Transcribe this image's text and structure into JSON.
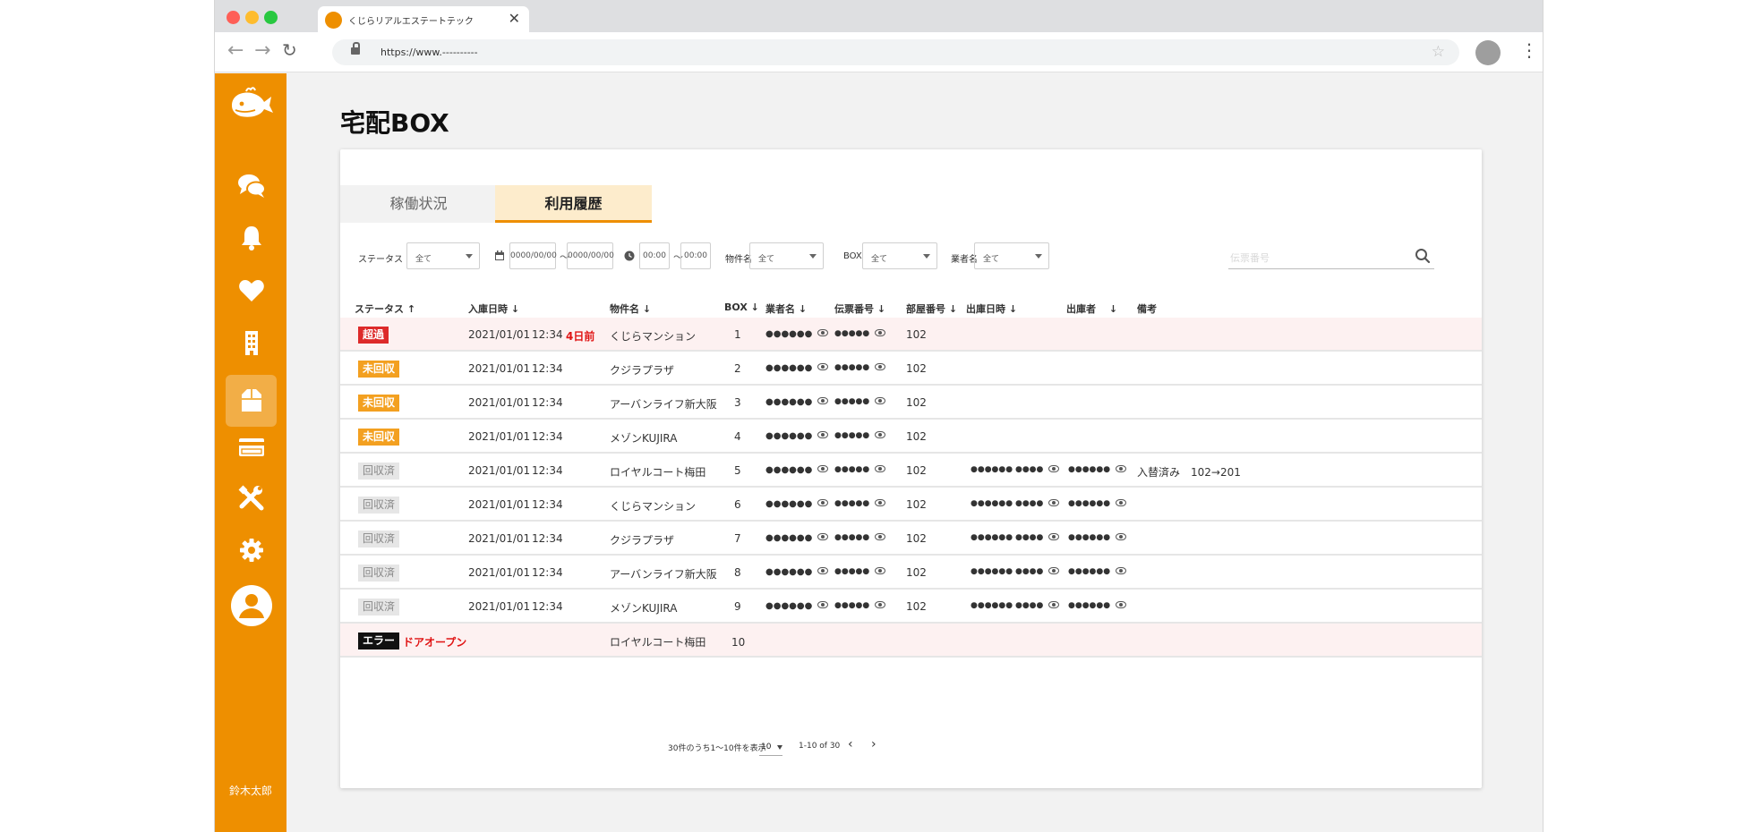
{
  "browser": {
    "tab_title": "くじらリアルエステートテック",
    "url": "https://www.----------"
  },
  "sidebar": {
    "user_name": "鈴木太郎"
  },
  "page": {
    "title": "宅配BOX"
  },
  "tabs": {
    "status": "稼働状況",
    "history": "利用履歴"
  },
  "filters": {
    "status_label": "ステータス",
    "status_value": "全て",
    "date_from": "0000/00/00",
    "date_to": "0000/00/00",
    "time_from": "00:00",
    "time_to": "00:00",
    "property_label": "物件名",
    "property_value": "全て",
    "box_label": "BOX",
    "box_value": "全て",
    "vendor_label": "業者名",
    "vendor_value": "全て",
    "search_placeholder": "伝票番号",
    "separator": "～"
  },
  "table": {
    "headers": {
      "status": "ステータス",
      "in_datetime": "入庫日時",
      "property": "物件名",
      "box": "BOX",
      "vendor": "業者名",
      "slip": "伝票番号",
      "room": "部屋番号",
      "out_datetime": "出庫日時",
      "out_person": "出庫者",
      "note": "備考"
    },
    "rows": [
      {
        "status": "超過",
        "date": "2021/01/01",
        "time": "12:34",
        "ago": "4日前",
        "property": "くじらマンション",
        "box": "1",
        "vendor": "●●●●●●",
        "slip": "●●●●●",
        "room": "102",
        "out": "",
        "outp": "",
        "note": ""
      },
      {
        "status": "未回収",
        "date": "2021/01/01",
        "time": "12:34",
        "ago": "",
        "property": "クジラプラザ",
        "box": "2",
        "vendor": "●●●●●●",
        "slip": "●●●●●",
        "room": "102",
        "out": "",
        "outp": "",
        "note": ""
      },
      {
        "status": "未回収",
        "date": "2021/01/01",
        "time": "12:34",
        "ago": "",
        "property": "アーバンライフ新大阪",
        "box": "3",
        "vendor": "●●●●●●",
        "slip": "●●●●●",
        "room": "102",
        "out": "",
        "outp": "",
        "note": ""
      },
      {
        "status": "未回収",
        "date": "2021/01/01",
        "time": "12:34",
        "ago": "",
        "property": "メゾンKUJIRA",
        "box": "4",
        "vendor": "●●●●●●",
        "slip": "●●●●●",
        "room": "102",
        "out": "",
        "outp": "",
        "note": ""
      },
      {
        "status": "回収済",
        "date": "2021/01/01",
        "time": "12:34",
        "ago": "",
        "property": "ロイヤルコート梅田",
        "box": "5",
        "vendor": "●●●●●●",
        "slip": "●●●●●",
        "room": "102",
        "out": "●●●●●● ●●●●",
        "outp": "●●●●●●",
        "note": "入替済み　102→201"
      },
      {
        "status": "回収済",
        "date": "2021/01/01",
        "time": "12:34",
        "ago": "",
        "property": "くじらマンション",
        "box": "6",
        "vendor": "●●●●●●",
        "slip": "●●●●●",
        "room": "102",
        "out": "●●●●●● ●●●●",
        "outp": "●●●●●●",
        "note": ""
      },
      {
        "status": "回収済",
        "date": "2021/01/01",
        "time": "12:34",
        "ago": "",
        "property": "クジラプラザ",
        "box": "7",
        "vendor": "●●●●●●",
        "slip": "●●●●●",
        "room": "102",
        "out": "●●●●●● ●●●●",
        "outp": "●●●●●●",
        "note": ""
      },
      {
        "status": "回収済",
        "date": "2021/01/01",
        "time": "12:34",
        "ago": "",
        "property": "アーバンライフ新大阪",
        "box": "8",
        "vendor": "●●●●●●",
        "slip": "●●●●●",
        "room": "102",
        "out": "●●●●●● ●●●●",
        "outp": "●●●●●●",
        "note": ""
      },
      {
        "status": "回収済",
        "date": "2021/01/01",
        "time": "12:34",
        "ago": "",
        "property": "メゾンKUJIRA",
        "box": "9",
        "vendor": "●●●●●●",
        "slip": "●●●●●",
        "room": "102",
        "out": "●●●●●● ●●●●",
        "outp": "●●●●●●",
        "note": ""
      }
    ],
    "error_row": {
      "status": "エラー",
      "message": "ドアオープン",
      "property": "ロイヤルコート梅田",
      "box": "10"
    }
  },
  "pagination": {
    "summary": "30件のうち1〜10件を表示",
    "per_page": "10",
    "range": "1-10 of 30",
    "prev": "‹",
    "next": "›"
  },
  "colors": {
    "accent": "#ee8f00",
    "overdue": "#dd2a2a",
    "uncollected": "#f3a020",
    "error": "#111111"
  }
}
